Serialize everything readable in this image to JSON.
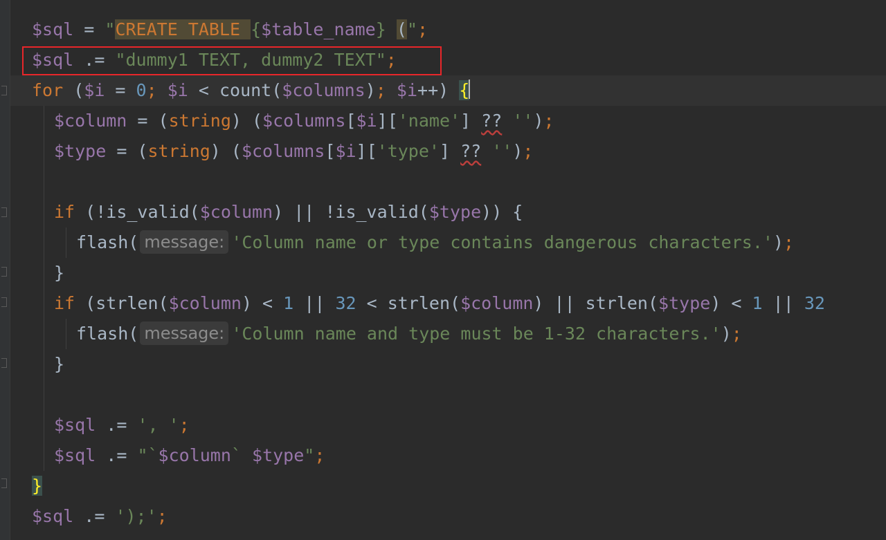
{
  "colors": {
    "background": "#2b2b2b",
    "variable": "#9876aa",
    "keyword": "#cc7832",
    "string": "#6a8759",
    "number": "#6897bb",
    "default": "#a9b7c6",
    "highlight_box": "#e8262a"
  },
  "code": {
    "line1": {
      "var": "$sql",
      "eq": " = ",
      "q_open": "\"",
      "create": "CREATE TABLE ",
      "ob": "{",
      "tname": "$table_name",
      "cb": "}",
      "sp": " ",
      "paren": "(",
      "q_close": "\"",
      "semi": ";"
    },
    "line2": {
      "var": "$sql",
      "op": " .= ",
      "str": "\"dummy1 TEXT, dummy2 TEXT\"",
      "semi": ";"
    },
    "line3": {
      "for": "for",
      "p1": " (",
      "i1": "$i",
      "eq": " = ",
      "zero": "0",
      "semi1": ";",
      "sp1": " ",
      "i2": "$i",
      "lt": " < count(",
      "cols": "$columns",
      "close": ")",
      "semi2": ";",
      "sp2": " ",
      "i3": "$i",
      "inc": "++) ",
      "brace": "{"
    },
    "line4": {
      "var": "$column",
      "eq": " = (",
      "cast": "string",
      "mid": ") (",
      "cols": "$columns",
      "b1": "[",
      "i": "$i",
      "b2": "][",
      "key": "'name'",
      "b3": "] ",
      "nc": "??",
      "sp": " ",
      "empty": "''",
      "close": ")",
      "semi": ";"
    },
    "line5": {
      "var": "$type",
      "eq": " = (",
      "cast": "string",
      "mid": ") (",
      "cols": "$columns",
      "b1": "[",
      "i": "$i",
      "b2": "][",
      "key": "'type'",
      "b3": "] ",
      "nc": "??",
      "sp": " ",
      "empty": "''",
      "close": ")",
      "semi": ";"
    },
    "line7": {
      "if": "if",
      "a": " (!is_valid(",
      "col": "$column",
      "b": ") || !is_valid(",
      "type": "$type",
      "c": ")) {"
    },
    "line8": {
      "fn": "flash(",
      "hint": "message:",
      "str": "'Column name or type contains dangerous characters.'",
      "close": ")",
      "semi": ";"
    },
    "line9": {
      "brace": "}"
    },
    "line10": {
      "if": "if",
      "a": " (strlen(",
      "col1": "$column",
      "b": ") < ",
      "one1": "1",
      "c": " || ",
      "n32a": "32",
      "d": " < strlen(",
      "col2": "$column",
      "e": ") || strlen(",
      "type": "$type",
      "f": ") < ",
      "one2": "1",
      "g": " || ",
      "n32b": "32"
    },
    "line11": {
      "fn": "flash(",
      "hint": "message:",
      "str": "'Column name and type must be 1-32 characters.'",
      "close": ")",
      "semi": ";"
    },
    "line12": {
      "brace": "}"
    },
    "line14": {
      "var": "$sql",
      "op": " .= ",
      "str": "', '",
      "semi": ";"
    },
    "line15": {
      "var": "$sql",
      "op": " .= ",
      "q1": "\"`",
      "col": "$column",
      "mid": "` ",
      "type": "$type",
      "q2": "\"",
      "semi": ";"
    },
    "line16": {
      "brace": "}"
    },
    "line17": {
      "var": "$sql",
      "op": " .= ",
      "str": "');'",
      "semi": ";"
    }
  }
}
